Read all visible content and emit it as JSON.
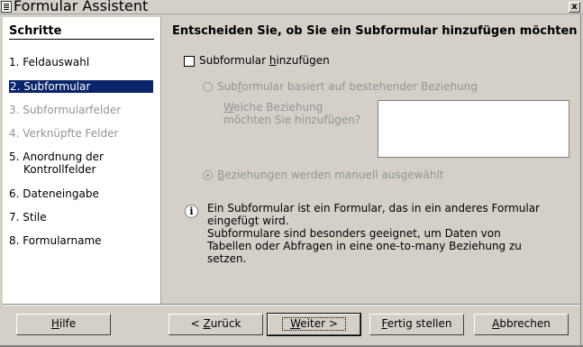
{
  "window": {
    "title": "Formular Assistent",
    "close_label": "x"
  },
  "steps": {
    "heading": "Schritte",
    "items": [
      {
        "label": "1. Feldauswahl",
        "state": "normal"
      },
      {
        "label": "2. Subformular",
        "state": "active"
      },
      {
        "label": "3. Subformularfelder",
        "state": "disabled"
      },
      {
        "label": "4. Verknüpfte Felder",
        "state": "disabled"
      },
      {
        "label_line1": "5. Anordnung der",
        "label_line2": "Kontrollfelder",
        "state": "normal"
      },
      {
        "label": "6. Dateneingabe",
        "state": "normal"
      },
      {
        "label": "7. Stile",
        "state": "normal"
      },
      {
        "label": "8. Formularname",
        "state": "normal"
      }
    ]
  },
  "content": {
    "title": "Entscheiden Sie, ob Sie ein Subformular hinzufügen möchten",
    "add_checkbox": {
      "pre": "Subformular ",
      "accel": "h",
      "post": "inzufügen",
      "checked": false
    },
    "radio_existing": {
      "pre": "Sub",
      "accel": "f",
      "post": "ormular basiert auf bestehender Beziehung",
      "checked": false
    },
    "relation_label": {
      "line1_accel": "W",
      "line1_post": "elche Beziehung",
      "line2": "möchten Sie hinzufügen?"
    },
    "radio_manual": {
      "accel": "B",
      "post": "eziehungen werden manuell ausgewählt",
      "checked": true
    },
    "info": {
      "line1": "Ein Subformular ist ein Formular, das in ein anderes Formular",
      "line2": "eingefügt wird.",
      "line3": "Subformulare sind besonders geeignet, um Daten von",
      "line4": "Tabellen oder Abfragen in eine one-to-many Beziehung zu",
      "line5": "setzen."
    }
  },
  "buttons": {
    "help": {
      "accel": "H",
      "post": "ilfe"
    },
    "back": {
      "pre": "< ",
      "accel": "Z",
      "post": "urück"
    },
    "next": {
      "accel": "W",
      "post": "eiter >"
    },
    "finish": {
      "accel": "F",
      "post": "ertig stellen"
    },
    "cancel": {
      "accel": "A",
      "post": "bbrechen"
    }
  },
  "colors": {
    "face": "#d4d0c8",
    "selection": "#0a246a",
    "disabled": "#949494"
  }
}
